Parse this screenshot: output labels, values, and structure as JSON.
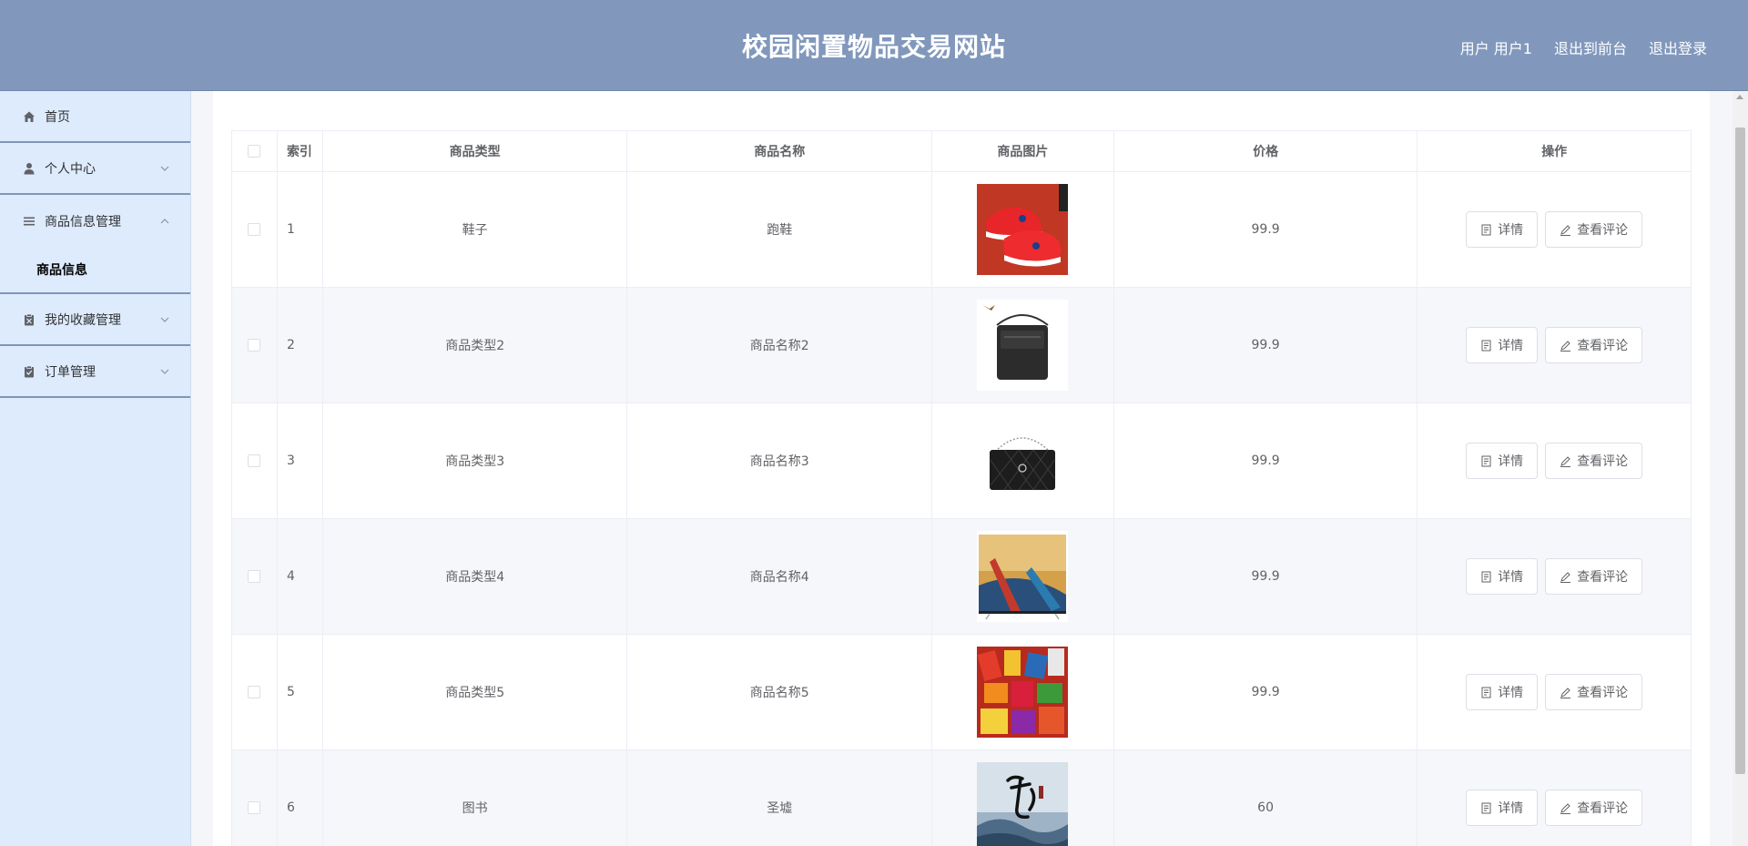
{
  "header": {
    "title": "校园闲置物品交易网站",
    "user_label": "用户 用户1",
    "to_front": "退出到前台",
    "logout": "退出登录"
  },
  "sidebar": {
    "items": [
      {
        "label": "首页",
        "icon": "home-icon"
      },
      {
        "label": "个人中心",
        "icon": "user-icon"
      },
      {
        "label": "商品信息管理",
        "icon": "menu-icon"
      },
      {
        "label": "我的收藏管理",
        "icon": "clipboard-icon"
      },
      {
        "label": "订单管理",
        "icon": "clipboard-check-icon"
      }
    ],
    "submenu": {
      "label": "商品信息"
    }
  },
  "table": {
    "headers": {
      "index": "索引",
      "type": "商品类型",
      "name": "商品名称",
      "image": "商品图片",
      "price": "价格",
      "ops": "操作"
    },
    "buttons": {
      "detail": "详情",
      "comments": "查看评论"
    },
    "rows": [
      {
        "index": "1",
        "type": "鞋子",
        "name": "跑鞋",
        "image": "red-running-shoes",
        "price": "99.9"
      },
      {
        "index": "2",
        "type": "商品类型2",
        "name": "商品名称2",
        "image": "black-shoulder-bag",
        "price": "99.9"
      },
      {
        "index": "3",
        "type": "商品类型3",
        "name": "商品名称3",
        "image": "black-quilted-handbag",
        "price": "99.9"
      },
      {
        "index": "4",
        "type": "商品类型4",
        "name": "商品名称4",
        "image": "tv-with-kayaks",
        "price": "99.9"
      },
      {
        "index": "5",
        "type": "商品类型5",
        "name": "商品名称5",
        "image": "colorful-snacks",
        "price": "99.9"
      },
      {
        "index": "6",
        "type": "图书",
        "name": "圣墟",
        "image": "book-cover-calligraphy",
        "price": "60"
      }
    ]
  },
  "colors": {
    "header_bg": "#8198bc",
    "sidebar_bg": "#deebfd",
    "divider": "#7f96b8"
  }
}
